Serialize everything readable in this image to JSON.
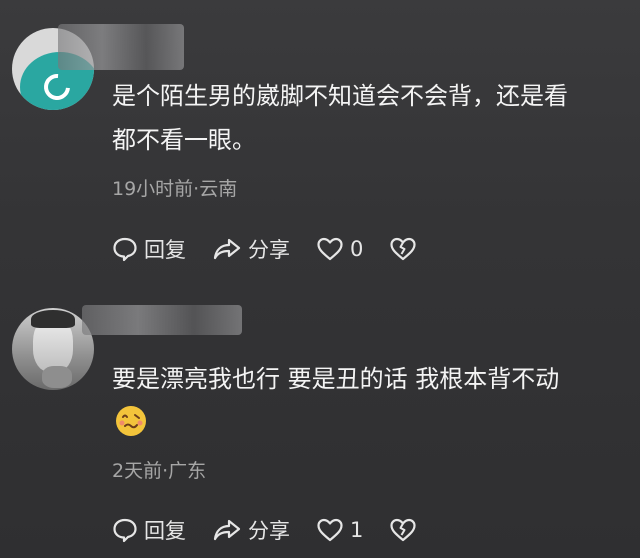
{
  "comments": [
    {
      "text_line1": "是个陌生男的崴脚不知道会不会背，还是看",
      "text_line2": "都不看一眼。",
      "meta": "19小时前·云南",
      "reply_label": "回复",
      "share_label": "分享",
      "like_count": "0",
      "avatar_icon": "teal-logo-avatar"
    },
    {
      "text_line1": "要是漂亮我也行 要是丑的话 我根本背不动",
      "emoji_icon": "woozy-face-emoji",
      "meta": "2天前·广东",
      "reply_label": "回复",
      "share_label": "分享",
      "like_count": "1",
      "avatar_icon": "man-portrait-avatar"
    }
  ],
  "colors": {
    "background": "#353537",
    "text": "#f4f4f4",
    "meta": "#a6a6a6",
    "accent": "#2aa7a1"
  }
}
